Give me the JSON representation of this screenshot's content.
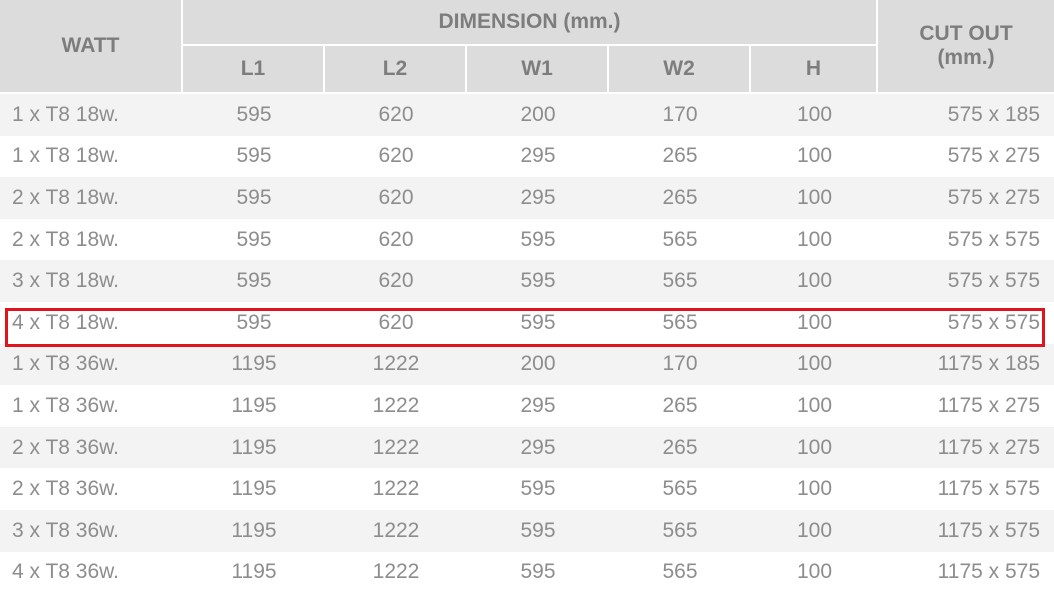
{
  "header": {
    "watt_label": "WATT",
    "dimension_label": "DIMENSION (mm.)",
    "cutout_label_line1": "CUT OUT",
    "cutout_label_line2": "(mm.)",
    "columns": [
      "L1",
      "L2",
      "W1",
      "W2",
      "H"
    ]
  },
  "rows": [
    {
      "watt": "1 x T8 18w.",
      "l1": "595",
      "l2": "620",
      "w1": "200",
      "w2": "170",
      "h": "100",
      "cutout": "575 x 185"
    },
    {
      "watt": "1 x T8 18w.",
      "l1": "595",
      "l2": "620",
      "w1": "295",
      "w2": "265",
      "h": "100",
      "cutout": "575 x 275"
    },
    {
      "watt": "2 x T8 18w.",
      "l1": "595",
      "l2": "620",
      "w1": "295",
      "w2": "265",
      "h": "100",
      "cutout": "575 x 275"
    },
    {
      "watt": "2 x T8 18w.",
      "l1": "595",
      "l2": "620",
      "w1": "595",
      "w2": "565",
      "h": "100",
      "cutout": "575 x 575"
    },
    {
      "watt": "3 x T8 18w.",
      "l1": "595",
      "l2": "620",
      "w1": "595",
      "w2": "565",
      "h": "100",
      "cutout": "575 x 575"
    },
    {
      "watt": "4 x T8 18w.",
      "l1": "595",
      "l2": "620",
      "w1": "595",
      "w2": "565",
      "h": "100",
      "cutout": "575 x 575"
    },
    {
      "watt": "1 x T8 36w.",
      "l1": "1195",
      "l2": "1222",
      "w1": "200",
      "w2": "170",
      "h": "100",
      "cutout": "1175 x 185"
    },
    {
      "watt": "1 x T8 36w.",
      "l1": "1195",
      "l2": "1222",
      "w1": "295",
      "w2": "265",
      "h": "100",
      "cutout": "1175 x 275"
    },
    {
      "watt": "2 x T8 36w.",
      "l1": "1195",
      "l2": "1222",
      "w1": "295",
      "w2": "265",
      "h": "100",
      "cutout": "1175 x 275"
    },
    {
      "watt": "2 x T8 36w.",
      "l1": "1195",
      "l2": "1222",
      "w1": "595",
      "w2": "565",
      "h": "100",
      "cutout": "1175 x 575"
    },
    {
      "watt": "3 x T8 36w.",
      "l1": "1195",
      "l2": "1222",
      "w1": "595",
      "w2": "565",
      "h": "100",
      "cutout": "1175 x 575"
    },
    {
      "watt": "4 x T8 36w.",
      "l1": "1195",
      "l2": "1222",
      "w1": "595",
      "w2": "565",
      "h": "100",
      "cutout": "1175 x 575"
    }
  ],
  "highlighted_row_index": 5,
  "colors": {
    "header_bg": "#dcdcdc",
    "stripe_bg": "#f3f3f3",
    "text": "#8d8d8d",
    "highlight_border": "#e0141c"
  }
}
